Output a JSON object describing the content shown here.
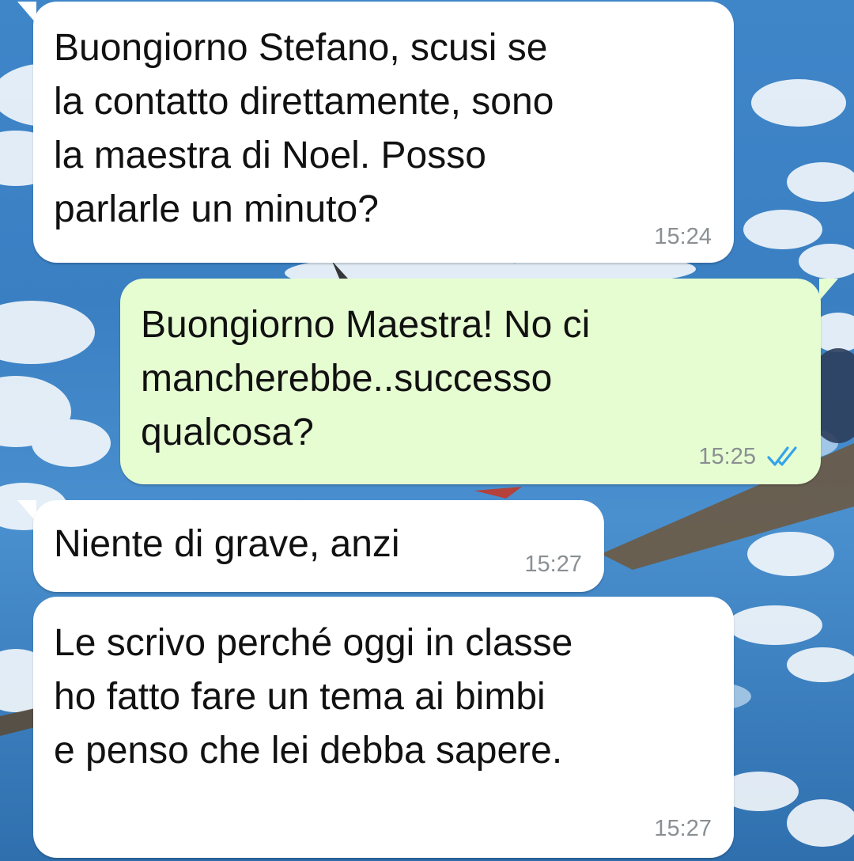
{
  "chat": {
    "wallpaper": "sky-with-airplane",
    "colors": {
      "incoming_bubble": "#ffffff",
      "outgoing_bubble": "#e6fdd2",
      "timestamp": "#8a8f93",
      "read_ticks": "#35a3ea"
    },
    "messages": [
      {
        "direction": "incoming",
        "text": "Buongiorno Stefano, scusi se\nla contatto direttamente, sono\nla maestra di Noel. Posso\nparlarle un minuto?",
        "time": "15:24"
      },
      {
        "direction": "outgoing",
        "text": "Buongiorno Maestra! No ci\nmancherebbe..successo\nqualcosa?",
        "time": "15:25",
        "status_icon": "double-check-read-icon"
      },
      {
        "direction": "incoming",
        "text": "Niente di grave, anzi",
        "time": "15:27"
      },
      {
        "direction": "incoming",
        "text": "Le scrivo perché oggi in classe\nho fatto fare un tema ai bimbi\ne penso che lei debba sapere.",
        "time": "15:27"
      }
    ]
  }
}
